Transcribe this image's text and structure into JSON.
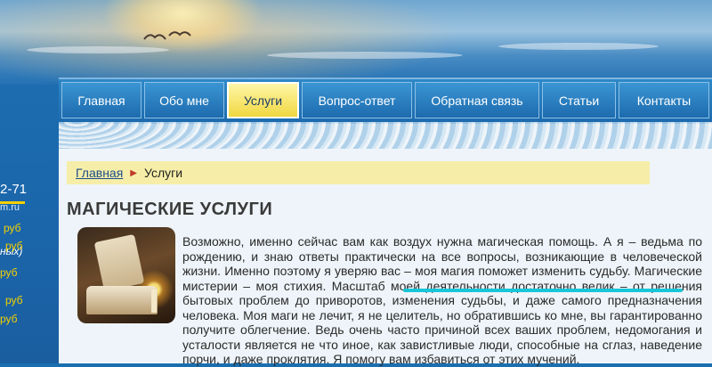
{
  "left_sidebar": {
    "phone_fragment": "2-71",
    "site_fragment": "m.ru",
    "note_fragment": "ных)",
    "price_fragments": [
      "руб",
      "руб",
      "руб",
      "руб",
      "руб"
    ]
  },
  "nav": {
    "items": [
      {
        "label": "Главная",
        "active": false
      },
      {
        "label": "Обо мне",
        "active": false
      },
      {
        "label": "Услуги",
        "active": true
      },
      {
        "label": "Вопрос-ответ",
        "active": false
      },
      {
        "label": "Обратная связь",
        "active": false
      },
      {
        "label": "Статьи",
        "active": false
      },
      {
        "label": "Контакты",
        "active": false
      }
    ]
  },
  "breadcrumb": {
    "home": "Главная",
    "current": "Услуги"
  },
  "main": {
    "title": "МАГИЧЕСКИЕ УСЛУГИ",
    "paragraph": "Возможно, именно сейчас вам как воздух нужна магическая помощь. А я – ведьма по рождению, и знаю ответы практически на все вопросы, возникающие в человеческой жизни. Именно поэтому я уверяю вас – моя магия поможет изменить судьбу. Магические мистерии – моя стихия. Масштаб моей деятельности достаточно велик – от решения бытовых проблем до приворотов, изменения судьбы, и даже самого предназначения человека. Моя маги не лечит, я не целитель, но обратившись ко мне, вы гарантированно получите облегчение. Ведь очень часто причиной всех ваших проблем, недомогания и усталости является не что иное, как завистливые люди, способные на сглаз, наведение порчи, и даже проклятия. Я помогу вам избавиться от этих мучений."
  },
  "colors": {
    "accent_yellow": "#f4d000",
    "nav_blue": "#1c6aad",
    "highlight_cyan": "#18c6d8"
  }
}
